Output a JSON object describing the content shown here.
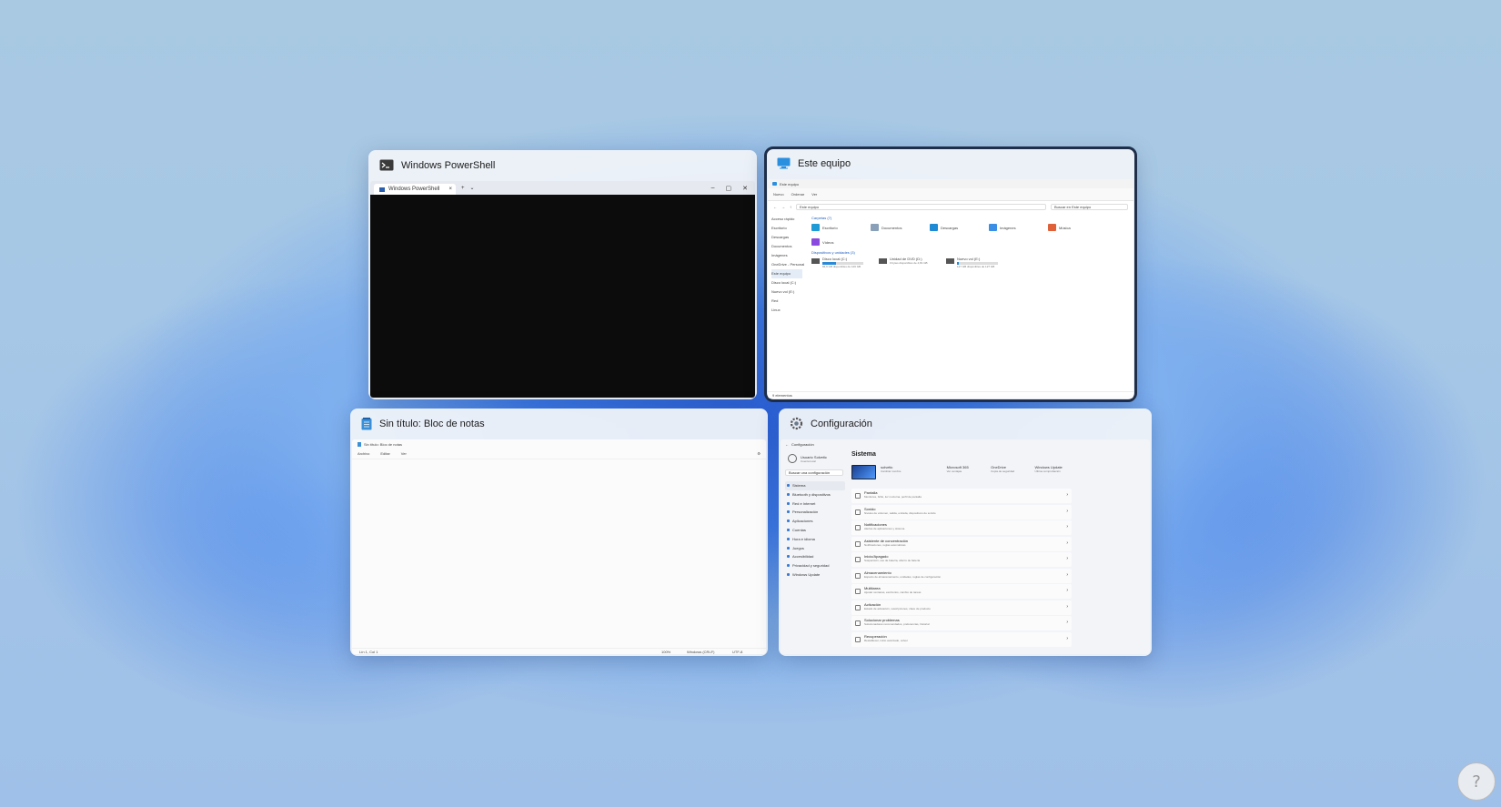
{
  "windows": {
    "powershell": {
      "title": "Windows PowerShell",
      "tab_label": "Windows PowerShell",
      "tab_close": "×",
      "new_tab": "+",
      "tab_menu": "⌄",
      "ctrl_min": "–",
      "ctrl_max": "▢",
      "ctrl_close": "✕"
    },
    "explorer": {
      "title": "Este equipo",
      "inner_title": "Este equipo",
      "cmd": [
        "Nuevo",
        "Ordenar",
        "Ver"
      ],
      "address": "Este equipo",
      "search": "Buscar en Este equipo",
      "sidebar": [
        "Acceso rápido",
        "Escritorio",
        "Descargas",
        "Documentos",
        "Imágenes",
        "OneDrive - Personal",
        "Este equipo",
        "Disco local (C:)",
        "Nuevo vol (E:)",
        "Red",
        "Linux"
      ],
      "section_folders": "Carpetas (7)",
      "folders": [
        {
          "name": "Escritorio",
          "color": "#1e9ad6"
        },
        {
          "name": "Documentos",
          "color": "#8aa0b8"
        },
        {
          "name": "Descargas",
          "color": "#1e8ad6"
        },
        {
          "name": "Imágenes",
          "color": "#3a8ee6"
        },
        {
          "name": "Música",
          "color": "#e0603a"
        },
        {
          "name": "Vídeos",
          "color": "#8a4ae0"
        }
      ],
      "section_drives": "Dispositivos y unidades (3)",
      "drives": [
        {
          "name": "Disco local (C:)",
          "info": "84,6 GB disponibles de 126 GB",
          "fill": 0.33
        },
        {
          "name": "Unidad de DVD (D:)",
          "info": "0 bytes disponibles de 4,81 GB",
          "fill": 0.0
        },
        {
          "name": "Nuevo vol (E:)",
          "info": "127 GB disponibles de 127 GB",
          "fill": 0.05
        }
      ],
      "status": "9 elementos"
    },
    "notepad": {
      "title": "Sin título: Bloc de notas",
      "inner_title": "Sin título: Bloc de notas",
      "menu": [
        "Archivo",
        "Editar",
        "Ver"
      ],
      "status_pos": "Lín 1, Col 1",
      "status_zoom": "100%",
      "status_eol": "Windows (CRLF)",
      "status_enc": "UTF-8"
    },
    "settings": {
      "title": "Configuración",
      "inner_title": "Configuración",
      "user_name": "Usuario Solvetic",
      "user_sub": "Cuenta local",
      "search": "Buscar una configuración",
      "heading": "Sistema",
      "nav": [
        "Sistema",
        "Bluetooth y dispositivos",
        "Red e Internet",
        "Personalización",
        "Aplicaciones",
        "Cuentas",
        "Hora e idioma",
        "Juegos",
        "Accesibilidad",
        "Privacidad y seguridad",
        "Windows Update"
      ],
      "device_name": "solvetic",
      "device_sub": "Cambiar nombre",
      "tiles": [
        {
          "name": "Microsoft 365",
          "sub": "Ver ventajas"
        },
        {
          "name": "OneDrive",
          "sub": "Copia de seguridad"
        },
        {
          "name": "Windows Update",
          "sub": "Última comprobación"
        }
      ],
      "items": [
        {
          "name": "Pantalla",
          "sub": "Monitores, brillo, luz nocturna, perfil de pantalla"
        },
        {
          "name": "Sonido",
          "sub": "Niveles de volumen, salida, entrada, dispositivos de sonido"
        },
        {
          "name": "Notificaciones",
          "sub": "Alertas de aplicaciones y sistema"
        },
        {
          "name": "Asistente de concentración",
          "sub": "Notificaciones, reglas automáticas"
        },
        {
          "name": "Inicio/Apagado",
          "sub": "Suspensión, uso de batería, ahorro de batería"
        },
        {
          "name": "Almacenamiento",
          "sub": "Espacio de almacenamiento, unidades, reglas de configuración"
        },
        {
          "name": "Multitarea",
          "sub": "Ajustar ventanas, escritorios, cambio de tareas"
        },
        {
          "name": "Activación",
          "sub": "Estado de activación, suscripciones, clave de producto"
        },
        {
          "name": "Solucionar problemas",
          "sub": "Solucionadores recomendados, preferencias, historial"
        },
        {
          "name": "Recuperación",
          "sub": "Restablecer, inicio avanzado, volver"
        }
      ]
    }
  },
  "help_glyph": "?"
}
